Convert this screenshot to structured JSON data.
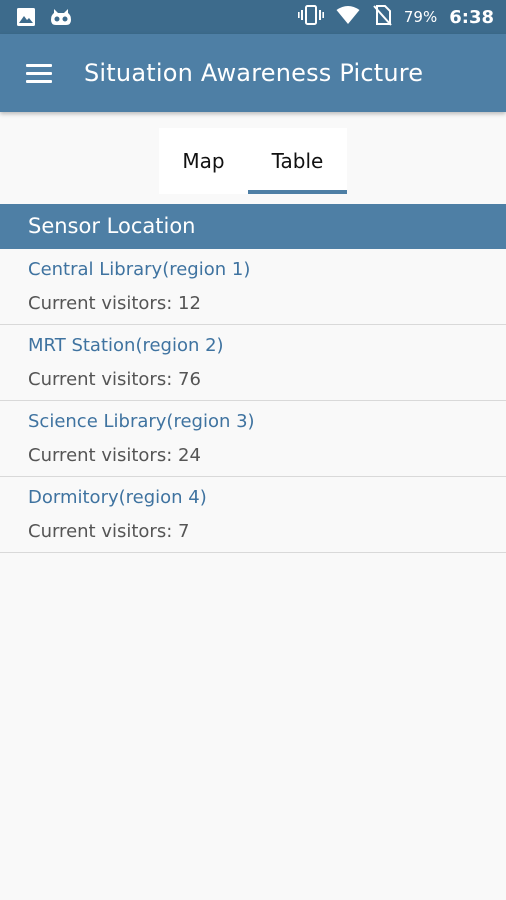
{
  "status_bar": {
    "left_icons": [
      "image-icon",
      "app-notification-icon"
    ],
    "right_icons": [
      "vibrate-icon",
      "wifi-icon",
      "no-sim-icon"
    ],
    "battery": "79%",
    "time": "6:38"
  },
  "app_bar": {
    "title": "Situation Awareness Picture",
    "menu_icon": "menu-icon"
  },
  "tabs": [
    {
      "label": "Map",
      "selected": false
    },
    {
      "label": "Table",
      "selected": true
    }
  ],
  "section": {
    "header": "Sensor Location"
  },
  "locations": [
    {
      "title": "Central Library(region 1)",
      "subtitle": "Current visitors: 12"
    },
    {
      "title": "MRT Station(region 2)",
      "subtitle": "Current visitors: 76"
    },
    {
      "title": "Science Library(region 3)",
      "subtitle": "Current visitors: 24"
    },
    {
      "title": "Dormitory(region 4)",
      "subtitle": "Current visitors: 7"
    }
  ],
  "colors": {
    "status_bar": "#3d6b8c",
    "primary": "#4e7fa5",
    "link_text": "#3f73a0",
    "background": "#f9f9f9"
  }
}
